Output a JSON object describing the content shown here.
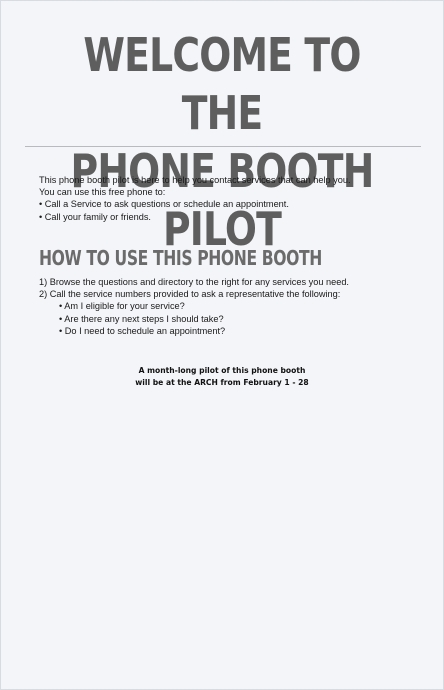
{
  "title": {
    "line1": "WELCOME TO THE",
    "line2": "PHONE BOOTH PILOT"
  },
  "intro": {
    "line1": "This phone booth pilot is here to help you contact services that can help you.",
    "line2": "You can use this free phone to:",
    "bullets": [
      "• Call a Service to ask questions or schedule an appointment.",
      "• Call your family or friends."
    ]
  },
  "how_to": {
    "heading": "HOW TO USE THIS PHONE BOOTH",
    "steps": [
      "1) Browse the questions and directory to the right for any services you need.",
      "2) Call the service numbers provided to ask a representative the following:"
    ],
    "questions": [
      "• Am I eligible for your service?",
      "• Are there any next steps I should take?",
      "• Do I need to schedule an appointment?"
    ]
  },
  "note": {
    "line1": "A month-long pilot of this phone booth",
    "line2": "will be at the ARCH from February 1 - 28"
  }
}
